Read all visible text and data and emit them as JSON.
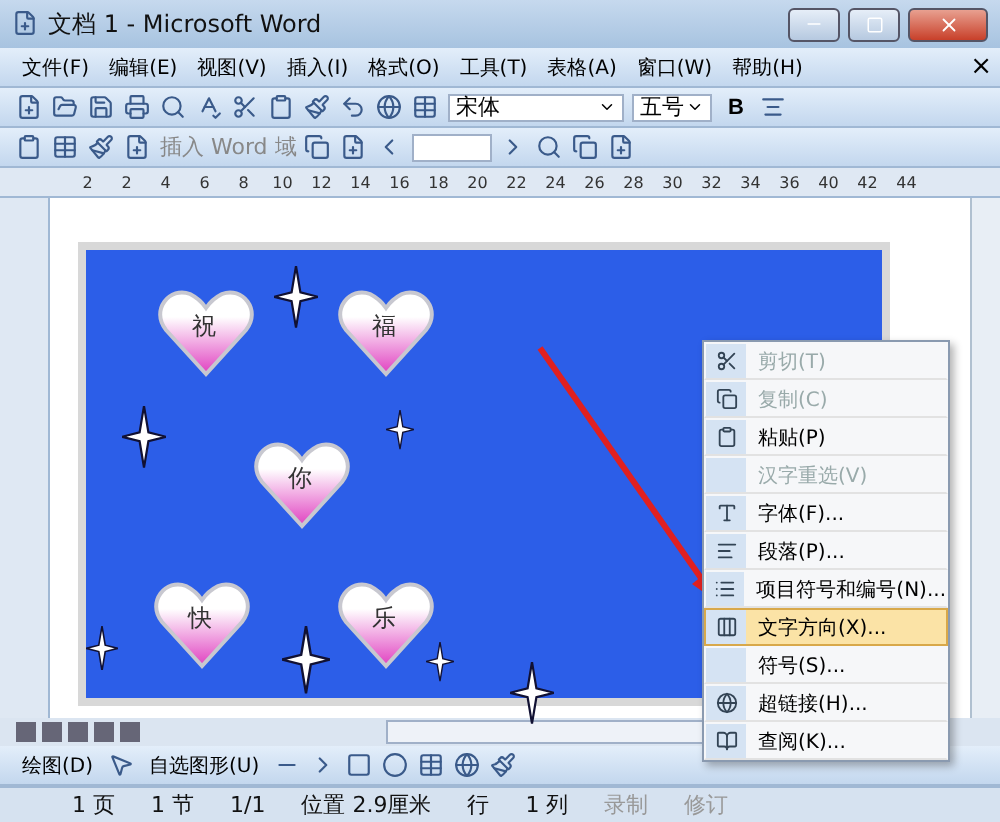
{
  "window": {
    "title": "文档 1 - Microsoft Word"
  },
  "menu_bar": {
    "items": [
      "文件(F)",
      "编辑(E)",
      "视图(V)",
      "插入(I)",
      "格式(O)",
      "工具(T)",
      "表格(A)",
      "窗口(W)",
      "帮助(H)"
    ],
    "close": "×"
  },
  "formatting": {
    "font": "宋体",
    "size": "五号",
    "bold": "B"
  },
  "mail_merge_toolbar": {
    "insert_field": "插入 Word 域"
  },
  "ruler": {
    "marks": [
      "2",
      "2",
      "4",
      "6",
      "8",
      "10",
      "12",
      "14",
      "16",
      "18",
      "20",
      "22",
      "24",
      "26",
      "28",
      "30",
      "32",
      "34",
      "36",
      "40",
      "42",
      "44"
    ]
  },
  "canvas": {
    "hearts": [
      {
        "label": "祝"
      },
      {
        "label": "福"
      },
      {
        "label": "你"
      },
      {
        "label": "快"
      },
      {
        "label": "乐"
      }
    ]
  },
  "context_menu": {
    "items": [
      {
        "label": "剪切(T)",
        "disabled": true,
        "selected": false
      },
      {
        "label": "复制(C)",
        "disabled": true,
        "selected": false
      },
      {
        "label": "粘贴(P)",
        "disabled": false,
        "selected": false
      },
      {
        "label": "汉字重选(V)",
        "disabled": true,
        "selected": false
      },
      {
        "label": "字体(F)...",
        "disabled": false,
        "selected": false
      },
      {
        "label": "段落(P)...",
        "disabled": false,
        "selected": false
      },
      {
        "label": "项目符号和编号(N)...",
        "disabled": false,
        "selected": false
      },
      {
        "label": "文字方向(X)...",
        "disabled": false,
        "selected": true
      },
      {
        "label": "符号(S)...",
        "disabled": false,
        "selected": false
      },
      {
        "label": "超链接(H)...",
        "disabled": false,
        "selected": false
      },
      {
        "label": "查阅(K)...",
        "disabled": false,
        "selected": false
      }
    ]
  },
  "drawing_toolbar": {
    "draw": "绘图(D)",
    "autoshapes": "自选图形(U)"
  },
  "status_bar": [
    "1 页",
    "1 节",
    "1/1",
    "位置 2.9厘米",
    "行",
    "1 列",
    "录制",
    "修订"
  ]
}
